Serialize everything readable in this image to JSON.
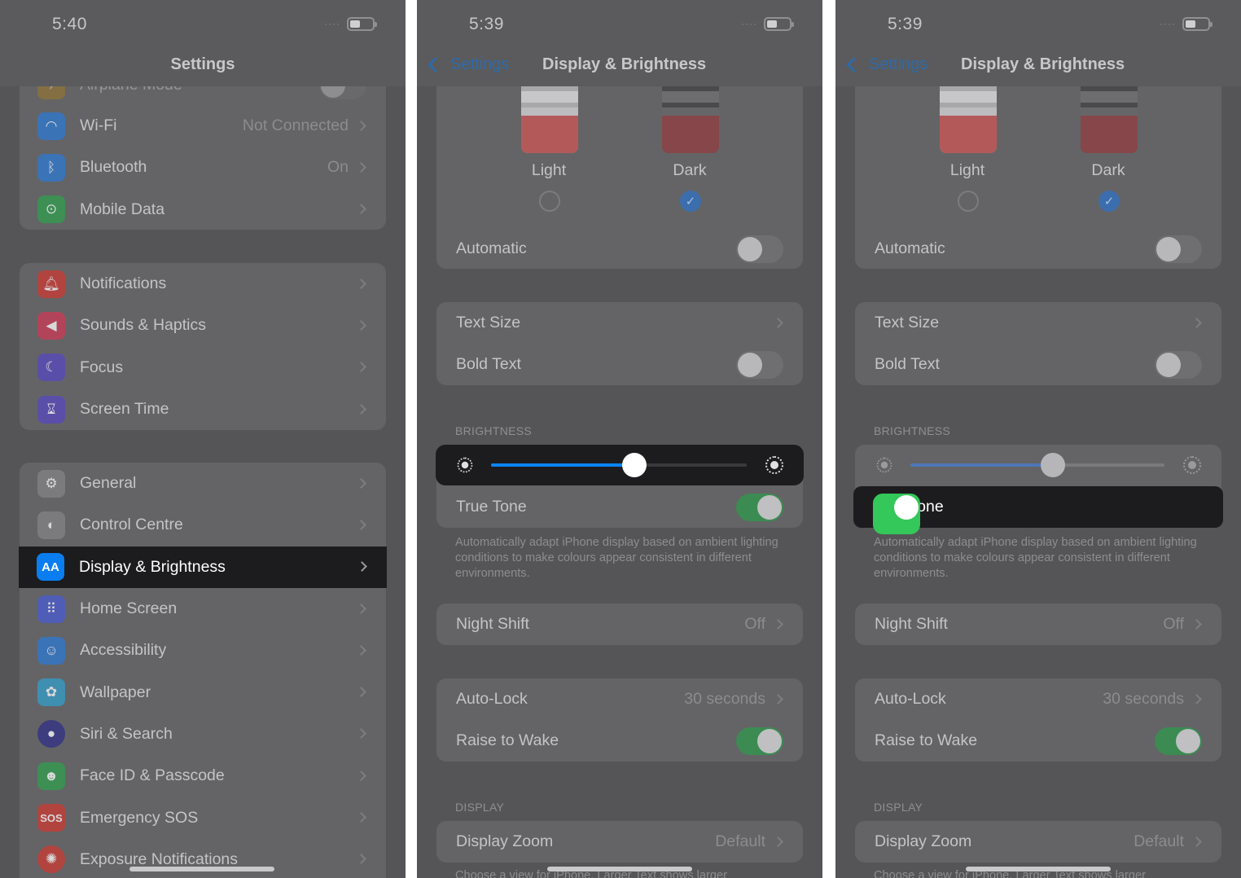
{
  "status": {
    "time1": "5:40",
    "time2": "5:39",
    "time3": "5:39",
    "dots": "····"
  },
  "settings": {
    "title": "Settings",
    "partial_label": "Airplane Mode",
    "group1": [
      {
        "label": "Wi-Fi",
        "value": "Not Connected",
        "icon": "wifi-icon"
      },
      {
        "label": "Bluetooth",
        "value": "On",
        "icon": "bluetooth-icon"
      },
      {
        "label": "Mobile Data",
        "value": "",
        "icon": "antenna-icon"
      }
    ],
    "group2": [
      {
        "label": "Notifications",
        "icon": "bell-icon"
      },
      {
        "label": "Sounds & Haptics",
        "icon": "speaker-icon"
      },
      {
        "label": "Focus",
        "icon": "moon-icon"
      },
      {
        "label": "Screen Time",
        "icon": "hourglass-icon"
      }
    ],
    "group3": [
      {
        "label": "General",
        "icon": "gear-icon"
      },
      {
        "label": "Control Centre",
        "icon": "switches-icon"
      },
      {
        "label": "Display & Brightness",
        "icon": "display-icon",
        "icon_text": "AA",
        "selected": true
      },
      {
        "label": "Home Screen",
        "icon": "grid-icon"
      },
      {
        "label": "Accessibility",
        "icon": "accessibility-icon"
      },
      {
        "label": "Wallpaper",
        "icon": "flower-icon"
      },
      {
        "label": "Siri & Search",
        "icon": "siri-icon"
      },
      {
        "label": "Face ID & Passcode",
        "icon": "face-id-icon"
      },
      {
        "label": "Emergency SOS",
        "icon": "sos-icon",
        "icon_text": "SOS"
      },
      {
        "label": "Exposure Notifications",
        "icon": "exposure-icon"
      }
    ]
  },
  "display": {
    "back_label": "Settings",
    "title": "Display & Brightness",
    "appearance": {
      "light": "Light",
      "dark": "Dark",
      "selected": "Dark",
      "automatic": "Automatic"
    },
    "text_size": "Text Size",
    "bold_text": "Bold Text",
    "brightness_header": "BRIGHTNESS",
    "brightness_level": 0.56,
    "true_tone": "True Tone",
    "true_tone_footer": "Automatically adapt iPhone display based on ambient lighting conditions to make colours appear consistent in different environments.",
    "night_shift": "Night Shift",
    "night_shift_value": "Off",
    "auto_lock": "Auto-Lock",
    "auto_lock_value": "30 seconds",
    "raise_to_wake": "Raise to Wake",
    "display_header": "DISPLAY",
    "display_zoom": "Display Zoom",
    "display_zoom_value": "Default",
    "zoom_footer_partial": "Choose a view for iPhone. Larger Text shows larger"
  },
  "colors": {
    "accent_blue": "#0a84ff",
    "toggle_green": "#34c759",
    "highlight_bg": "#1c1c1e"
  }
}
